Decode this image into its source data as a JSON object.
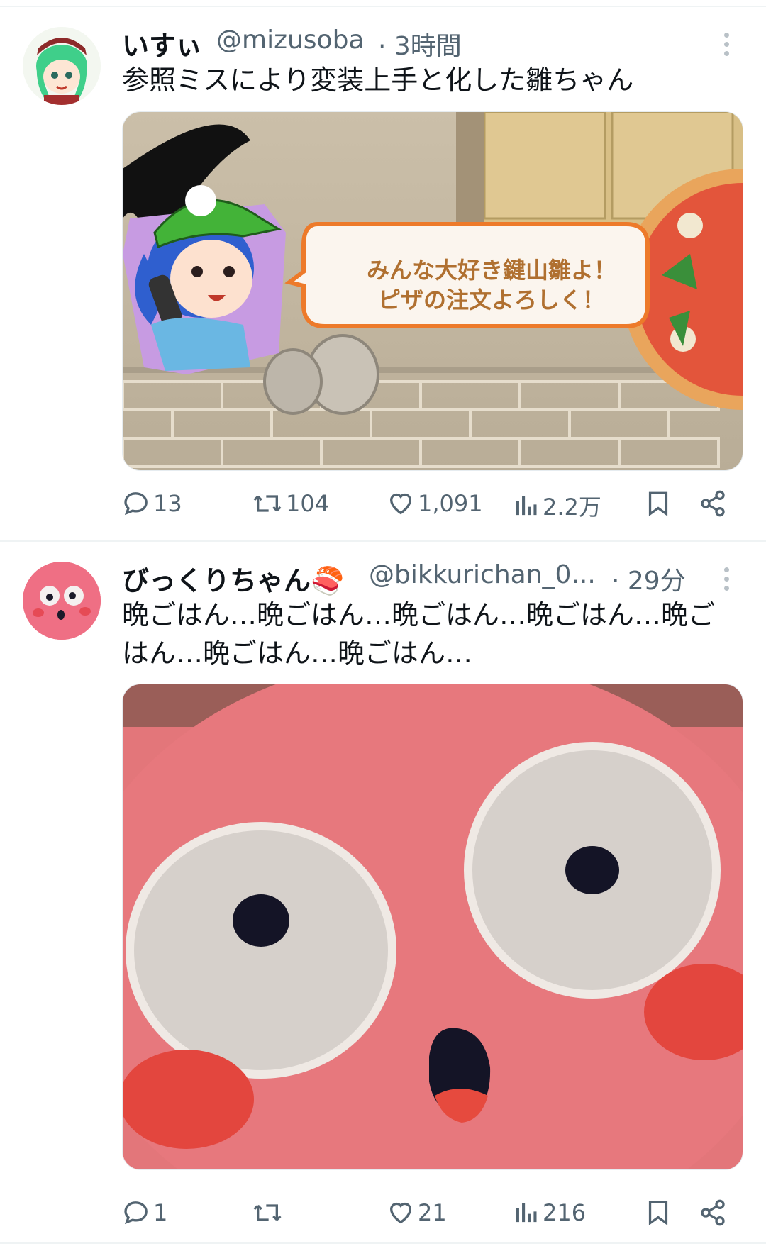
{
  "tweets": [
    {
      "display_name": "いすぃ",
      "handle": "@mizusoba",
      "time": "· 3時間",
      "text": "参照ミスにより変装上手と化した雛ちゃん",
      "image": {
        "speech_line1": "みんな大好き鍵山雛よ！",
        "speech_line2": "ピザの注文よろしく！"
      },
      "stats": {
        "replies": "13",
        "retweets": "104",
        "likes": "1,091",
        "views": "2.2万"
      }
    },
    {
      "display_name": "びっくりちゃん🍣",
      "handle": "@bikkurichan_0...",
      "time": "· 29分",
      "text": "晩ごはん…晩ごはん…晩ごはん…晩ごはん…晩ごはん…晩ごはん…晩ごはん…",
      "stats": {
        "replies": "1",
        "retweets": "",
        "likes": "21",
        "views": "216"
      }
    }
  ],
  "icons": [
    "reply-icon",
    "retweet-icon",
    "like-icon",
    "views-icon",
    "bookmark-icon",
    "share-icon",
    "more-icon"
  ],
  "colors": {
    "text": "#0f1419",
    "secondary": "#536471",
    "divider": "#eff3f4"
  }
}
